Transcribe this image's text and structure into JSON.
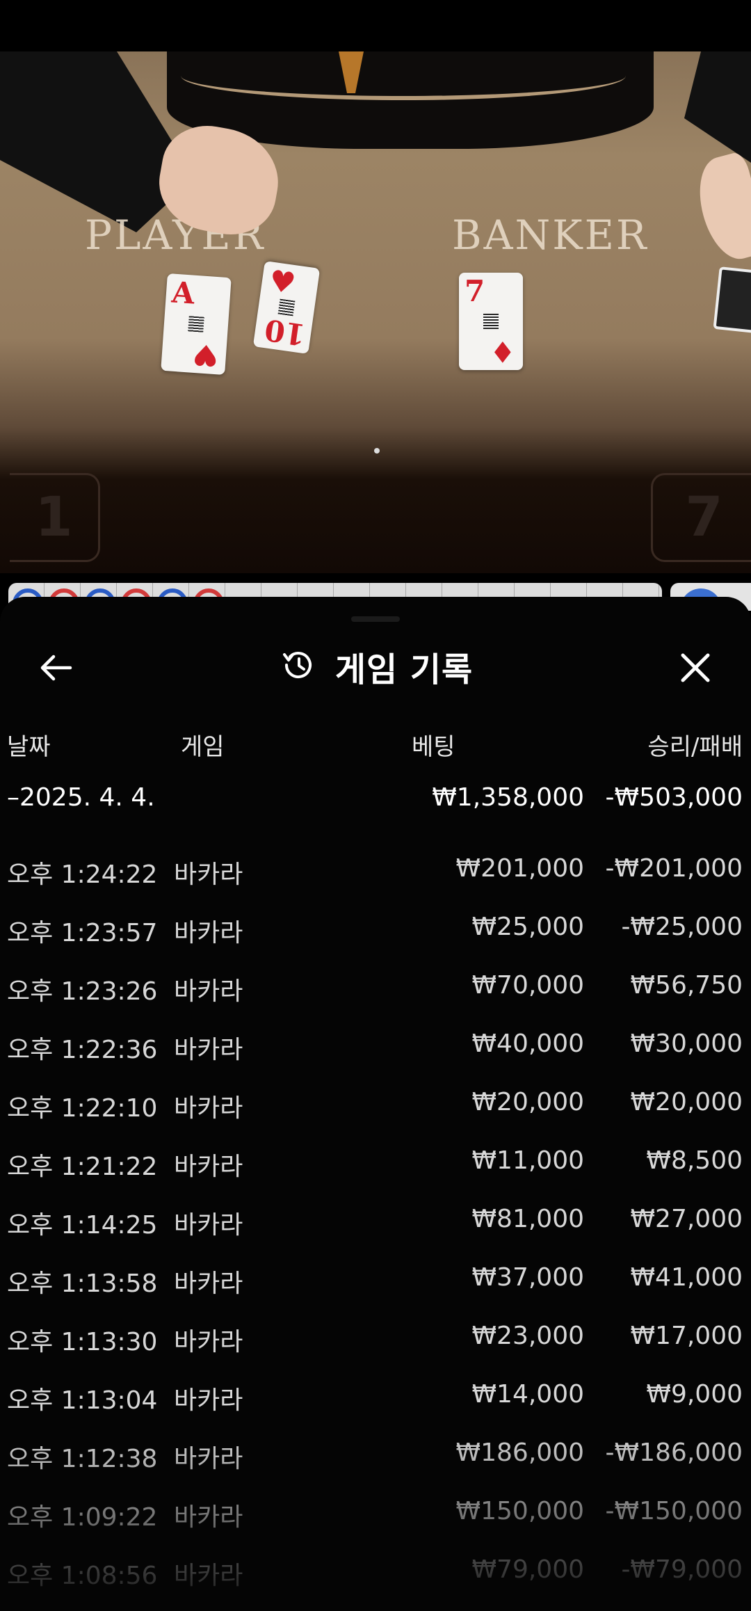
{
  "video": {
    "player_label": "PLAYER",
    "banker_label": "BANKER",
    "player_cards": [
      {
        "rank": "A",
        "suit": "♥"
      },
      {
        "rank": "10",
        "suit": "♥"
      }
    ],
    "banker_cards": [
      {
        "rank": "7",
        "suit": "♦"
      }
    ],
    "player_score": "1",
    "banker_score": "7"
  },
  "road_colors": [
    "#2a5bc4",
    "#d13a3a",
    "#2a5bc4",
    "#d13a3a",
    "#2a5bc4",
    "#d13a3a"
  ],
  "sheet": {
    "title": "게임 기록",
    "icons": {
      "back": "arrow-left-icon",
      "history": "history-icon",
      "close": "close-icon"
    },
    "columns": {
      "date": "날짜",
      "game": "게임",
      "bet": "베팅",
      "result": "승리/패배"
    },
    "summary": {
      "date": "–2025. 4. 4.",
      "bet": "₩1,358,000",
      "result": "-₩503,000"
    },
    "rows": [
      {
        "time": "오후 1:24:22",
        "game": "바카라",
        "bet": "₩201,000",
        "result": "-₩201,000"
      },
      {
        "time": "오후 1:23:57",
        "game": "바카라",
        "bet": "₩25,000",
        "result": "-₩25,000"
      },
      {
        "time": "오후 1:23:26",
        "game": "바카라",
        "bet": "₩70,000",
        "result": "₩56,750"
      },
      {
        "time": "오후 1:22:36",
        "game": "바카라",
        "bet": "₩40,000",
        "result": "₩30,000"
      },
      {
        "time": "오후 1:22:10",
        "game": "바카라",
        "bet": "₩20,000",
        "result": "₩20,000"
      },
      {
        "time": "오후 1:21:22",
        "game": "바카라",
        "bet": "₩11,000",
        "result": "₩8,500"
      },
      {
        "time": "오후 1:14:25",
        "game": "바카라",
        "bet": "₩81,000",
        "result": "₩27,000"
      },
      {
        "time": "오후 1:13:58",
        "game": "바카라",
        "bet": "₩37,000",
        "result": "₩41,000"
      },
      {
        "time": "오후 1:13:30",
        "game": "바카라",
        "bet": "₩23,000",
        "result": "₩17,000"
      },
      {
        "time": "오후 1:13:04",
        "game": "바카라",
        "bet": "₩14,000",
        "result": "₩9,000"
      },
      {
        "time": "오후 1:12:38",
        "game": "바카라",
        "bet": "₩186,000",
        "result": "-₩186,000"
      },
      {
        "time": "오후 1:09:22",
        "game": "바카라",
        "bet": "₩150,000",
        "result": "-₩150,000"
      },
      {
        "time": "오후 1:08:56",
        "game": "바카라",
        "bet": "₩79,000",
        "result": "-₩79,000"
      }
    ]
  }
}
